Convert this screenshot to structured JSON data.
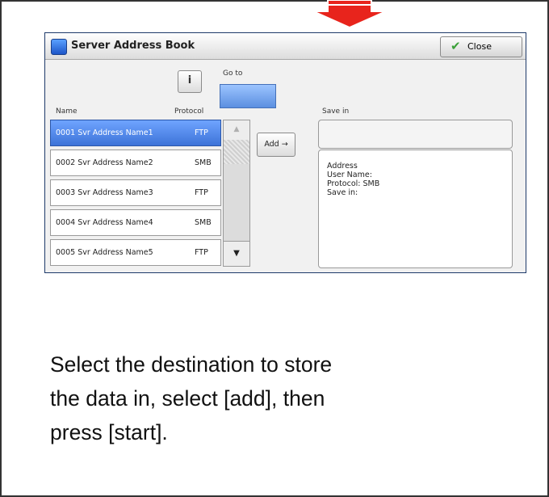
{
  "window": {
    "title": "Server Address Book",
    "close_label": "Close",
    "info_label": "i",
    "goto_label": "Go to",
    "goto_value": "",
    "headers": {
      "name": "Name",
      "protocol": "Protocol",
      "save_in": "Save in"
    },
    "entries": [
      {
        "name": "0001  Svr Address Name1",
        "protocol": "FTP",
        "selected": true
      },
      {
        "name": "0002  Svr Address Name2",
        "protocol": "SMB",
        "selected": false
      },
      {
        "name": "0003  Svr Address Name3",
        "protocol": "FTP",
        "selected": false
      },
      {
        "name": "0004  Svr Address Name4",
        "protocol": "SMB",
        "selected": false
      },
      {
        "name": "0005  Svr Address Name5",
        "protocol": "FTP",
        "selected": false
      }
    ],
    "add_label": "Add →",
    "save_in_value": "",
    "details": {
      "address": "Address",
      "user_name": "User Name:",
      "protocol": "Protocol: SMB",
      "save_in": "Save in:"
    }
  },
  "caption": {
    "line1": "Select the destination to store",
    "line2": "the data in, select [add], then",
    "line3": "press [start]."
  },
  "colors": {
    "arrow": "#e8241c",
    "selection": "#3d73d8",
    "frame_border": "#1e3a6a"
  }
}
